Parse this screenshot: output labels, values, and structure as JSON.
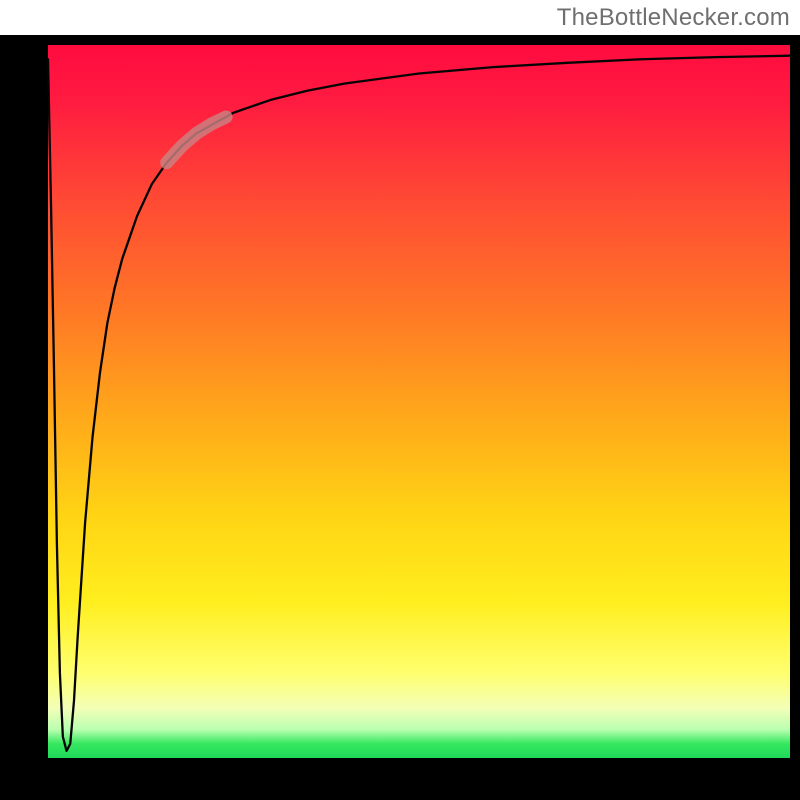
{
  "watermark": "TheBottleNecker.com",
  "colors": {
    "frame": "#000000",
    "curve": "#050505",
    "highlight": "#c98383",
    "gradient_top": "#ff0b3f",
    "gradient_bottom": "#1fd85a"
  },
  "chart_data": {
    "type": "line",
    "title": "",
    "xlabel": "",
    "ylabel": "",
    "xlim": [
      0,
      100
    ],
    "ylim": [
      0,
      100
    ],
    "grid": false,
    "legend": false,
    "background_gradient": {
      "direction": "vertical",
      "start": "#ff0b3f",
      "end": "#1fd85a"
    },
    "series": [
      {
        "name": "bottleneck-curve",
        "color": "#000000",
        "comment": "thin black curve: steep drop near x≈0 to y≈0, then asymptotic rise toward y≈100",
        "x": [
          0.0,
          0.4,
          0.8,
          1.2,
          1.6,
          2.0,
          2.5,
          3.0,
          3.5,
          4.0,
          5.0,
          6.0,
          7.0,
          8.0,
          9.0,
          10,
          12,
          14,
          16,
          18,
          20,
          25,
          30,
          35,
          40,
          50,
          60,
          70,
          80,
          90,
          100
        ],
        "y": [
          98,
          78,
          55,
          30,
          12,
          3,
          1,
          2,
          8,
          17,
          33,
          45,
          54,
          61,
          66,
          70,
          76,
          80.5,
          83.5,
          85.8,
          87.6,
          90.5,
          92.3,
          93.6,
          94.6,
          96.0,
          96.9,
          97.5,
          98.0,
          98.3,
          98.5
        ]
      },
      {
        "name": "highlight-segment",
        "color": "#c98383",
        "comment": "short thick salmon segment along curve near upper-left bend",
        "x": [
          16,
          18,
          20,
          22,
          24
        ],
        "y": [
          83.5,
          85.8,
          87.6,
          88.9,
          89.9
        ]
      }
    ]
  }
}
